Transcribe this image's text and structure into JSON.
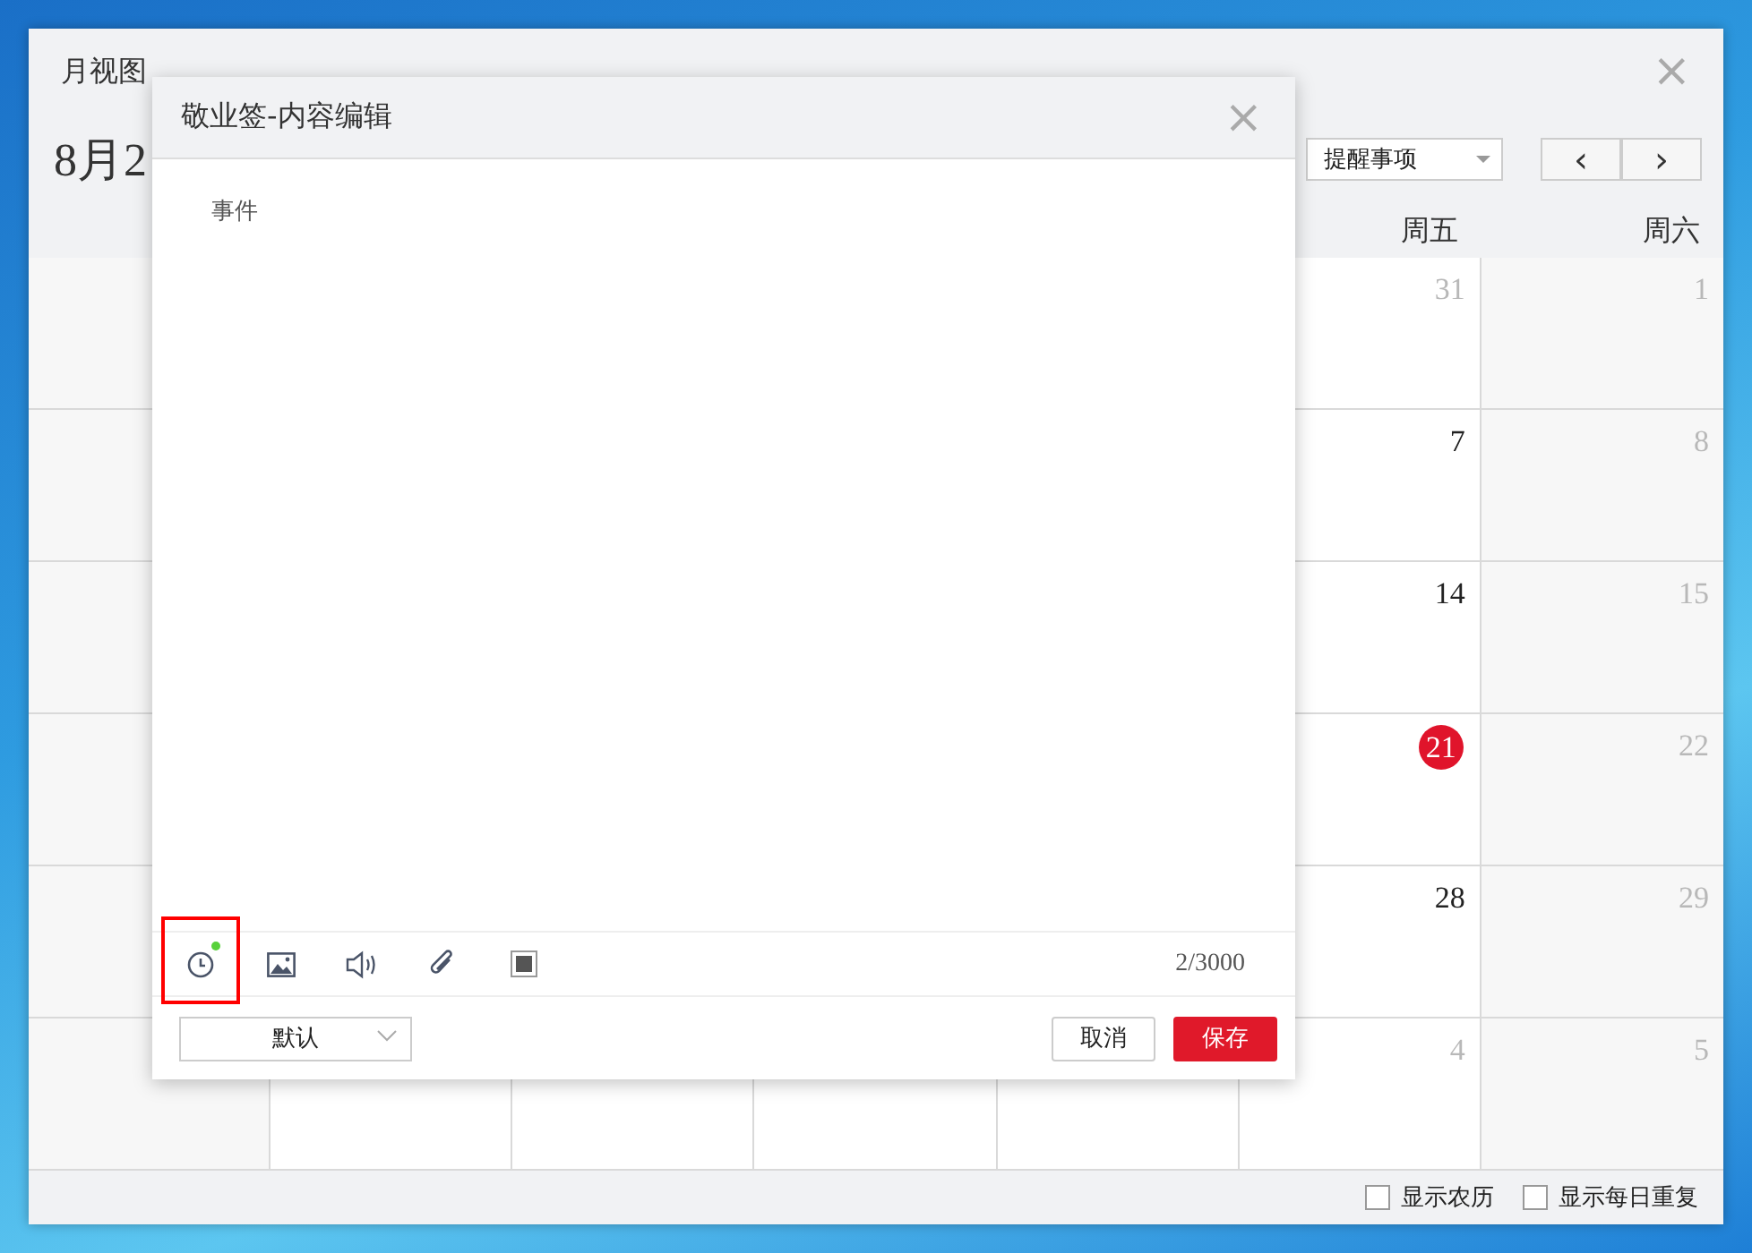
{
  "window": {
    "title": "月视图",
    "close": "×"
  },
  "header": {
    "month_title": "8月2",
    "filter_select": {
      "value": "提醒事项"
    },
    "nav": [
      "‹",
      "›"
    ]
  },
  "calendar": {
    "weekday_headers": [
      "周五",
      "周六"
    ],
    "rows": [
      {
        "cells": [
          {
            "day": "31",
            "muted": true,
            "today": false
          },
          {
            "day": "1",
            "muted": true,
            "today": false
          }
        ]
      },
      {
        "cells": [
          {
            "day": "7",
            "muted": false,
            "today": false
          },
          {
            "day": "8",
            "muted": true,
            "today": false
          }
        ]
      },
      {
        "cells": [
          {
            "day": "14",
            "muted": false,
            "today": false
          },
          {
            "day": "15",
            "muted": true,
            "today": false
          }
        ]
      },
      {
        "cells": [
          {
            "day": "21",
            "today": true
          },
          {
            "day": "22",
            "muted": true,
            "today": false
          }
        ]
      },
      {
        "cells": [
          {
            "day": "28",
            "muted": false,
            "today": false
          },
          {
            "day": "29",
            "muted": true,
            "today": false
          }
        ]
      },
      {
        "cells": [
          {
            "day": "4",
            "muted": true,
            "today": false
          },
          {
            "day": "5",
            "muted": true,
            "today": false
          }
        ]
      }
    ]
  },
  "options": [
    {
      "label": "显示农历",
      "checked": false
    },
    {
      "label": "显示每日重复",
      "checked": false
    }
  ],
  "dialog": {
    "title": "敬业签-内容编辑",
    "close": "×",
    "content": "事件",
    "toolbar": [
      {
        "kind": "clock",
        "reminder_set": true,
        "highlighted": true
      },
      {
        "kind": "image",
        "reminder_set": false,
        "highlighted": false
      },
      {
        "kind": "sound",
        "reminder_set": false,
        "highlighted": false
      },
      {
        "kind": "attachment",
        "reminder_set": false,
        "highlighted": false
      },
      {
        "kind": "stop",
        "reminder_set": false,
        "highlighted": false
      }
    ],
    "counter": "2/3000",
    "category_select": {
      "value": "默认"
    },
    "cancel": "取消",
    "save": "保存"
  }
}
